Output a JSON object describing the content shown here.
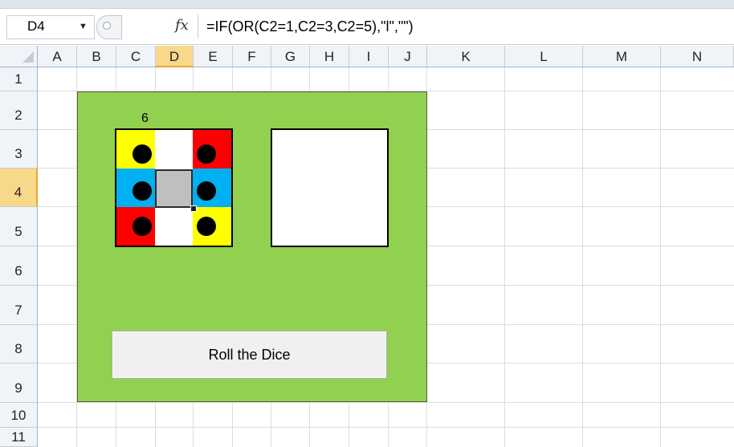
{
  "formula_bar": {
    "name_box": "D4",
    "fx_label": "fx",
    "formula": "=IF(OR(C2=1,C2=3,C2=5),\"l\",\"\")"
  },
  "grid": {
    "columns": [
      "A",
      "B",
      "C",
      "D",
      "E",
      "F",
      "G",
      "H",
      "I",
      "J",
      "K",
      "L",
      "M",
      "N"
    ],
    "rows": [
      "1",
      "2",
      "3",
      "4",
      "5",
      "6",
      "7",
      "8",
      "9",
      "10",
      "11"
    ],
    "selected_column": "D",
    "selected_row": "4"
  },
  "game": {
    "counter_value": "6",
    "button_label": "Roll the Dice",
    "colors": {
      "board": "#92d050",
      "yellow": "#ffff00",
      "red": "#ff0000",
      "blue": "#00b0f0",
      "selected_cell": "#bfbfbf"
    }
  }
}
